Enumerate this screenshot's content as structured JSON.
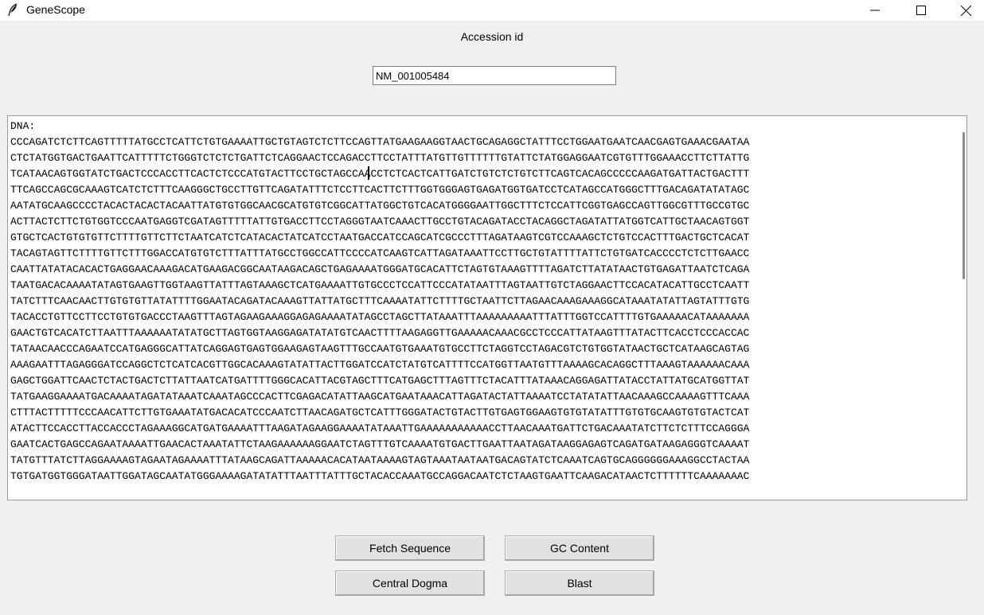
{
  "window": {
    "title": "GeneScope"
  },
  "accession": {
    "label": "Accession id",
    "value": "NM_001005484"
  },
  "sequence_box": {
    "lines": [
      "DNA:",
      "CCCAGATCTCTTCAGTTTTTATGCCTCATTCTGTGAAAATTGCTGTAGTCTCTTCCAGTTATGAAGAAGGTAACTGCAGAGGCTATTTCCTGGAATGAATCAACGAGTGAAACGAATAA",
      "CTCTATGGTGACTGAATTCATTTTTCTGGGTCTCTCTGATTCTCAGGAACTCCAGACCTTCCTATTTATGTTGTTTTTTGTATTCTATGGAGGAATCGTGTTTGGAAACCTTCTTATTG",
      "TCATAACAGTGGTATCTGACTCCCACCTTCACTCTCCCATGTACTTCCTGCTAGCCAACCTCTCACTCATTGATCTGTCTCTGTCTTCAGTCACAGCCCCCAAGATGATTACTGACTTT",
      "TTCAGCCAGCGCAAAGTCATCTCTTTCAAGGGCTGCCTTGTTCAGATATTTCTCCTTCACTTCTTTGGTGGGAGTGAGATGGTGATCCTCATAGCCATGGGCTTTGACAGATATATAGC",
      "AATATGCAAGCCCCTACACTACACTACAATTATGTGTGGCAACGCATGTGTCGGCATTATGGCTGTCACATGGGGAATTGGCTTTCTCCATTCGGTGAGCCAGTTGGCGTTTGCCGTGC",
      "ACTTACTCTTCTGTGGTCCCAATGAGGTCGATAGTTTTTATTGTGACCTTCCTAGGGTAATCAAACTTGCCTGTACAGATACCTACAGGCTAGATATTATGGTCATTGCTAACAGTGGT",
      "GTGCTCACTGTGTGTTCTTTTGTTCTTCTAATCATCTCATACACTATCATCCTAATGACCATCCAGCATCGCCCTTTAGATAAGTCGTCCAAAGCTCTGTCCACTTTGACTGCTCACAT",
      "TACAGTAGTTCTTTTGTTCTTTGGACCATGTGTCTTTATTTATGCCTGGCCATTCCCCATCAAGTCATTAGATAAATTCCTTGCTGTATTTTATTCTGTGATCACCCCTCTCTTGAACC",
      "CAATTATATACACACTGAGGAACAAAGACATGAAGACGGCAATAAGACAGCTGAGAAAATGGGATGCACATTCTAGTGTAAAGTTTTAGATCTTATATAACTGTGAGATTAATCTCAGA",
      "TAATGACACAAAATATAGTGAAGTTGGTAAGTTATTTAGTAAAGCTCATGAAAATTGTGCCCTCCATTCCCATATAATTTAGTAATTGTCTAGGAACTTCCACATACATTGCCTCAATT",
      "TATCTTTCAACAACTTGTGTGTTATATTTTGGAATACAGATACAAAGTTATTATGCTTTCAAAATATTCTTTTGCTAATTCTTAGAACAAAGAAAGGCATAAATATATTAGTATTTGTG",
      "TACACCTGTTCCTTCCTGTGTGACCCTAAGTTTAGTAGAAGAAAGGAGAGAAAATATAGCCTAGCTTATAAATTTAAAAAAAAATTTATTTGGTCCATTTTGTGAAAAACATAAAAAAA",
      "GAACTGTCACATCTTAATTTAAAAAATATATGCTTAGTGGTAAGGAGATATATGTCAACTTTTAAGAGGTTGAAAAACAAACGCCTCCCATTATAAGTTTATACTTCACCTCCCACCAC",
      "TATAACAACCCAGAATCCATGAGGGCATTATCAGGAGTGAGTGGAAGAGTAAGTTTGCCAATGTGAAATGTGCCTTCTAGGTCCTAGACGTCTGTGGTATAACTGCTCATAAGCAGTAG",
      "AAAGAATTTAGAGGGATCCAGGCTCTCATCACGTTGGCACAAAGTATATTACTTGGATCCATCTATGTCATTTTCCATGGTTAATGTTTAAAAGCACAGGCTTTAAAGTAAAAAACAAA",
      "GAGCTGGATTCAACTCTACTGACTCTTATTAATCATGATTTTGGGCACATTACGTAGCTTTCATGAGCTTTAGTTTCTACATTTATAAACAGGAGATTATACCTATTATGCATGGTTAT",
      "TATGAAGGAAAATGACAAAATAGATATAAATCAAATAGCCCACTTCGAGACATATTAAGCATGAATAAACATTAGATACTATTAAAATCCTATATATTAACAAAGCCAAAAGTTTCAAA",
      "CTTTACTTTTTCCCAACATTCTTGTGAAATATGACACATCCCAATCTTAACAGATGCTCATTTGGGATACTGTACTTGTGAGTGGAAGTGTGTATATTTGTGTGCAAGTGTGTACTCAT",
      "ATACTTCCACCTTACCACCCTAGAAAGGCATGATGAAAATTTAAGATAGAAGGAAAATATAAATTGAAAAAAAAAAACCTTAACAAATGATTCTGACAAATATCTTCTCTTTCCAGGGA",
      "GAATCACTGAGCCAGAATAAAATTGAACACTAAATATTCTAAGAAAAAAGGAATCTAGTTTGTCAAAATGTGACTTGAATTAATAGATAAGGAGAGTCAGATGATAAGAGGGTCAAAAT",
      "TATGTTTATCTTAGGAAAAGTAGAATAGAAAATTTATAAGCAGATTAAAAACACATAATAAAAGTAGTAAATAATAATGACAGTATCTCAAATCAGTGCAGGGGGGAAAGGCCTACTAA",
      "TGTGATGGTGGGATAATTGGATAGCAATATGGGAAAAGATATATTTAATTTATTTGCTACACCAAATGCCAGGACAATCTCTAAGTGAATTCAAGACATAACTCTTTTTTCAAAAAAAC"
    ]
  },
  "buttons": {
    "fetch": "Fetch Sequence",
    "gc": "GC Content",
    "dogma": "Central Dogma",
    "blast": "Blast"
  },
  "icons": {
    "app": "feather-icon",
    "minimize": "minimize-icon",
    "maximize": "maximize-icon",
    "close": "close-icon"
  }
}
